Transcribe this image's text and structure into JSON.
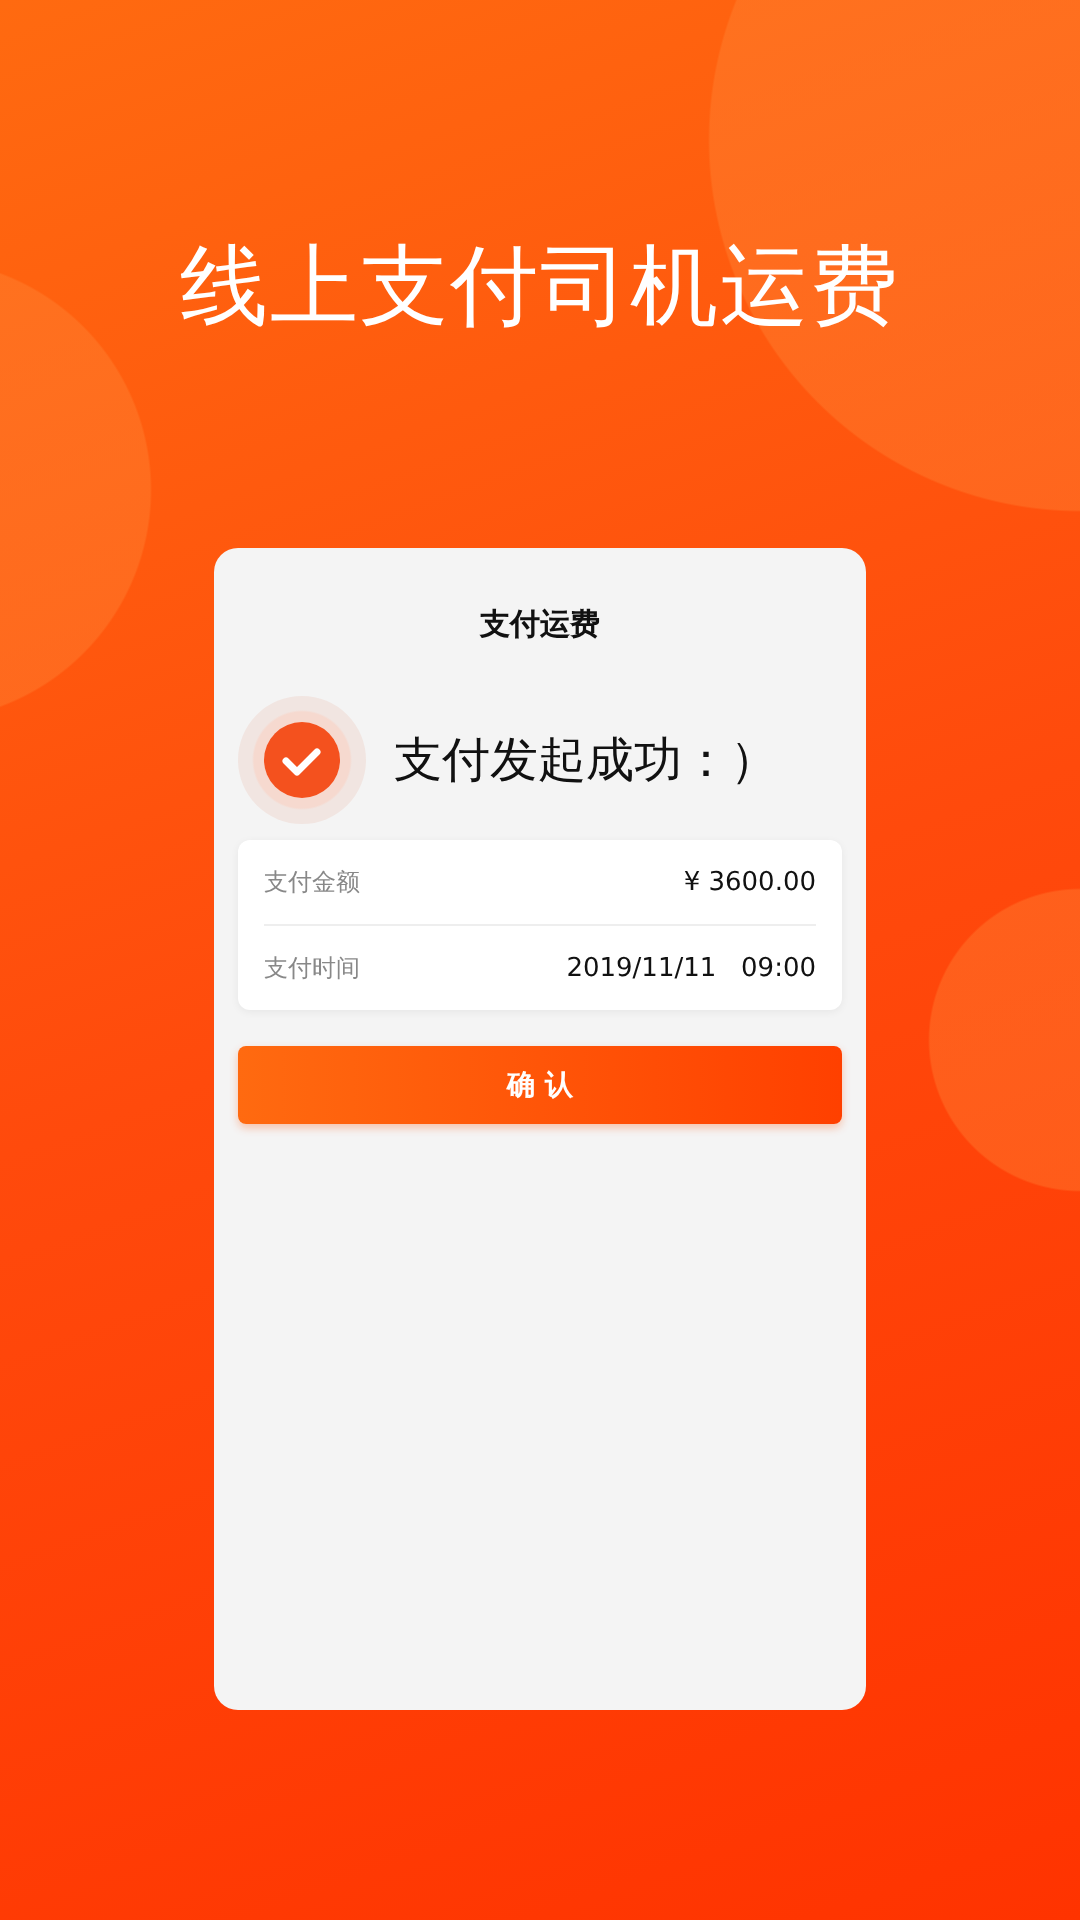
{
  "headline": "线上支付司机运费",
  "card": {
    "title": "支付运费",
    "status": "支付发起成功：）",
    "details": [
      {
        "label": "支付金额",
        "value": "¥ 3600.00"
      },
      {
        "label": "支付时间",
        "value": "2019/11/11   09:00"
      }
    ],
    "confirm_button": "确 认"
  }
}
